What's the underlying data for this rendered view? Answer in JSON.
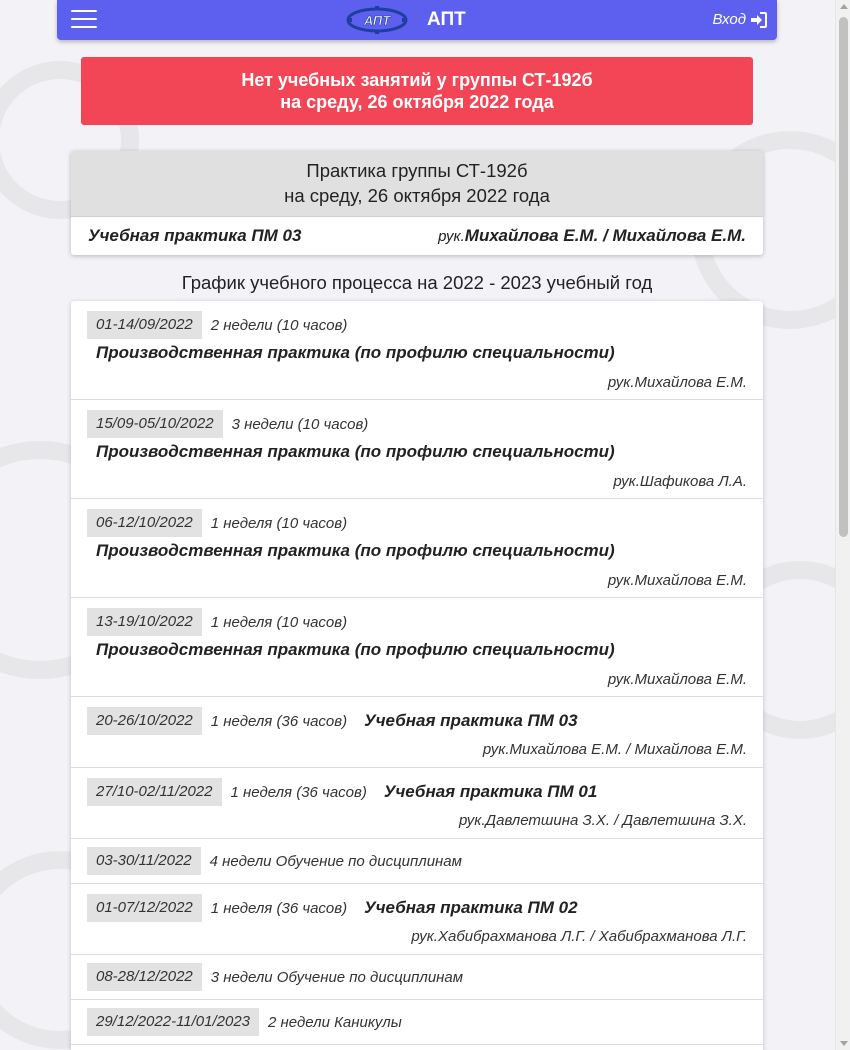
{
  "navbar": {
    "brand": "АПТ",
    "logo_text": "АПТ",
    "login_label": "Вход",
    "color": "#5d5fef"
  },
  "alert": {
    "line1": "Нет учебных занятий у группы СТ-192б",
    "line2": "на среду, 26 октября 2022 года",
    "color": "#f24656"
  },
  "practice": {
    "title_line1": "Практика группы СТ-192б",
    "title_line2": "на среду, 26 октября 2022 года",
    "subject": "Учебная практика ПМ 03",
    "teacher_prefix": "рук.",
    "teacher_names": "Михайлова Е.М. / Михайлова Е.М."
  },
  "schedule": {
    "title": "График учебного процесса на 2022 - 2023 учебный год",
    "items": [
      {
        "date": "01-14/09/2022",
        "duration": "2 недели (10 часов)",
        "title": "Производственная практика (по профилю специальности)",
        "teacher": "рук.Михайлова Е.М."
      },
      {
        "date": "15/09-05/10/2022",
        "duration": "3 недели (10 часов)",
        "title": "Производственная практика (по профилю специальности)",
        "teacher": "рук.Шафикова Л.А."
      },
      {
        "date": "06-12/10/2022",
        "duration": "1 неделя (10 часов)",
        "title": "Производственная практика (по профилю специальности)",
        "teacher": "рук.Михайлова Е.М."
      },
      {
        "date": "13-19/10/2022",
        "duration": "1 неделя (10 часов)",
        "title": "Производственная практика (по профилю специальности)",
        "teacher": "рук.Михайлова Е.М."
      },
      {
        "date": "20-26/10/2022",
        "duration": "1 неделя (36 часов)",
        "title": "Учебная практика ПМ 03",
        "teacher": "рук.Михайлова Е.М. / Михайлова Е.М."
      },
      {
        "date": "27/10-02/11/2022",
        "duration": "1 неделя (36 часов)",
        "title": "Учебная практика ПМ 01",
        "teacher": "рук.Давлетшина З.Х. / Давлетшина З.Х."
      },
      {
        "date": "03-30/11/2022",
        "duration": "4 недели  Обучение по дисциплинам"
      },
      {
        "date": "01-07/12/2022",
        "duration": "1 неделя (36 часов)",
        "title": "Учебная практика ПМ 02",
        "teacher": "рук.Хабибрахманова Л.Г. / Хабибрахманова Л.Г."
      },
      {
        "date": "08-28/12/2022",
        "duration": "3 недели  Обучение по дисциплинам"
      },
      {
        "date": "29/12/2022-11/01/2023",
        "duration": "2 недели  Каникулы"
      }
    ]
  }
}
